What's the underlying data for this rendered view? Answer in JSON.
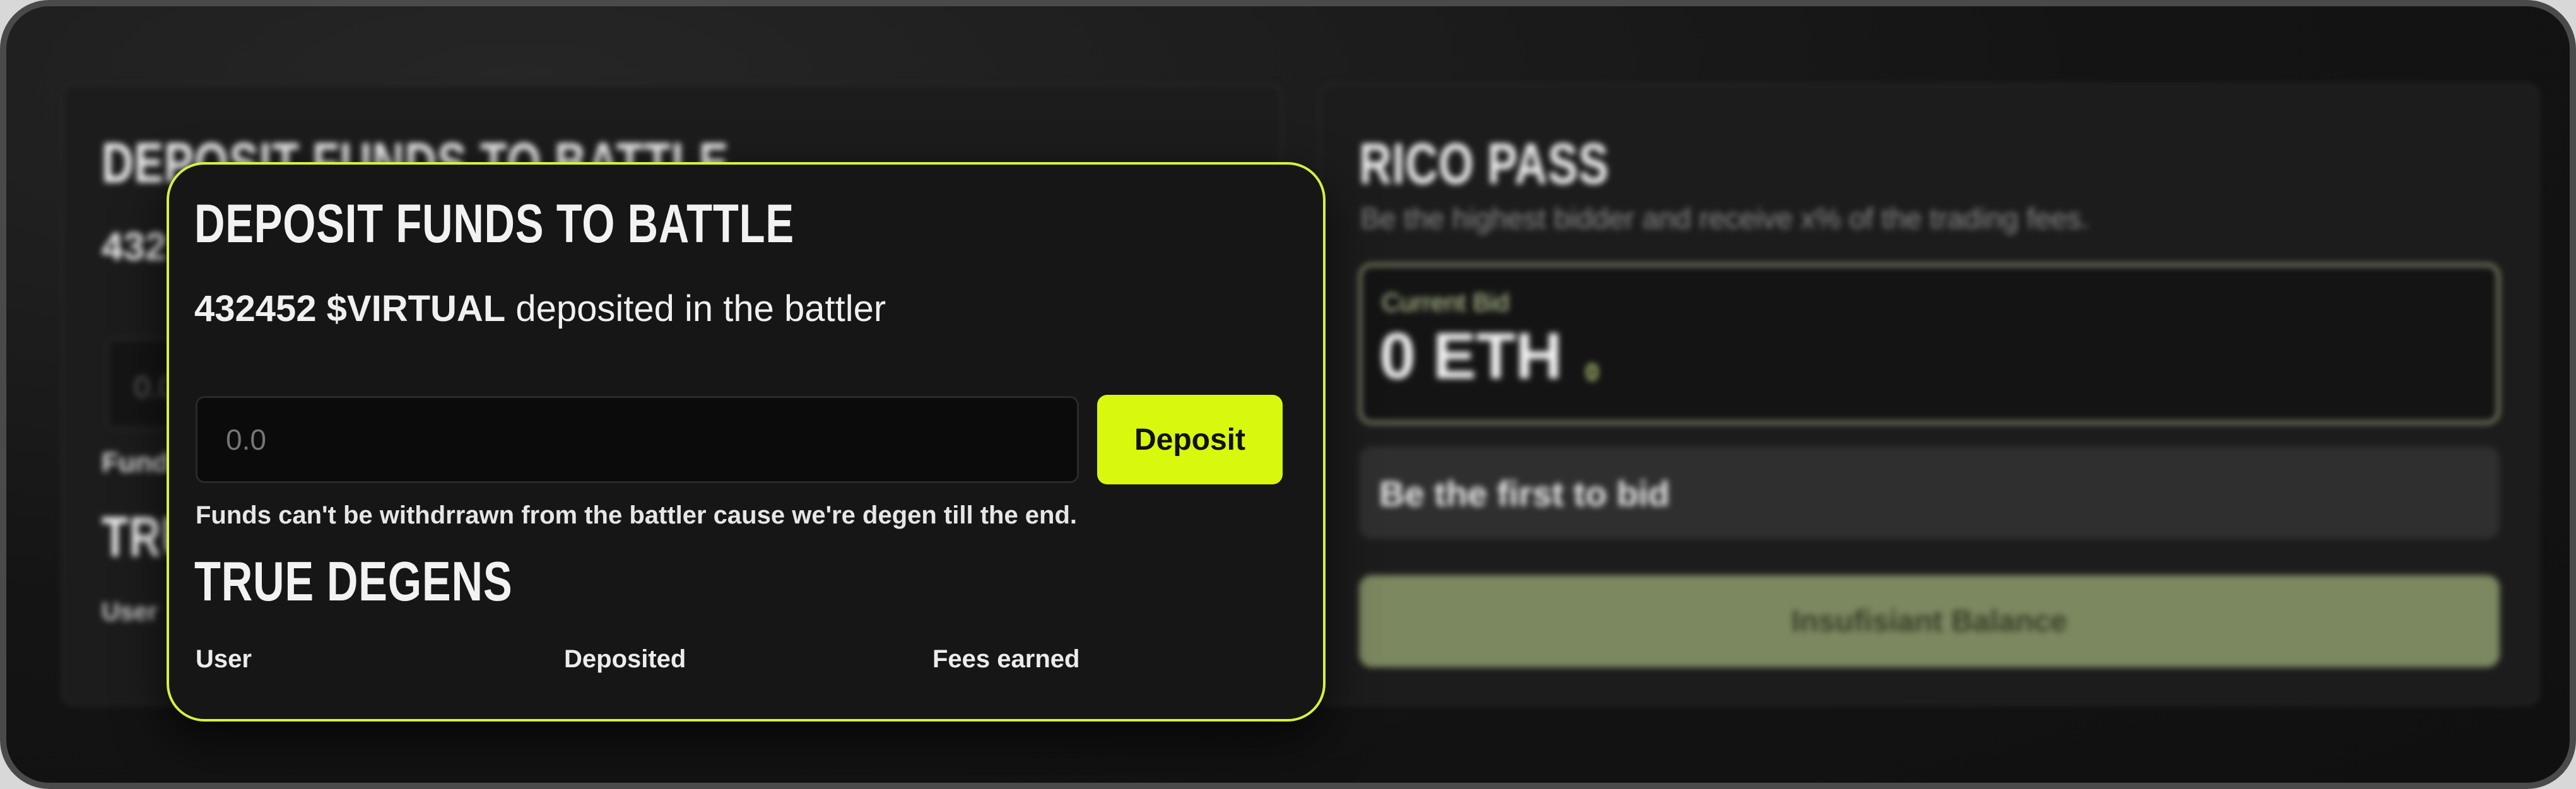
{
  "background_panel": {
    "title": "DEPOSIT FUNDS TO BATTLE",
    "amount_prefix": "432",
    "input_placeholder": "0.0",
    "note_prefix": "Fund",
    "section_prefix": "TRU",
    "column_prefix": "User"
  },
  "modal": {
    "title": "DEPOSIT FUNDS TO BATTLE",
    "amount": "432452 $VIRTUAL",
    "amount_suffix": "deposited in the battler",
    "input_placeholder": "0.0",
    "deposit_label": "Deposit",
    "note": "Funds can't be withdrrawn from the battler cause we're degen till the end.",
    "section_title": "TRUE DEGENS",
    "columns": [
      "User",
      "Deposited",
      "Fees earned"
    ]
  },
  "rico_pass": {
    "title": "RICO PASS",
    "subtitle": "Be the highest bidder and receive x% of the trading fees.",
    "current_bid_label": "Current Bid",
    "current_bid_value": "0 ETH",
    "current_bid_small": "0",
    "first_bid_text": "Be the first to bid",
    "insufficient_label": "Insufisiant Balance"
  },
  "colors": {
    "accent": "#d8f80d",
    "insufficient_bg": "#7c8860",
    "frame": "#4a4a4a"
  }
}
